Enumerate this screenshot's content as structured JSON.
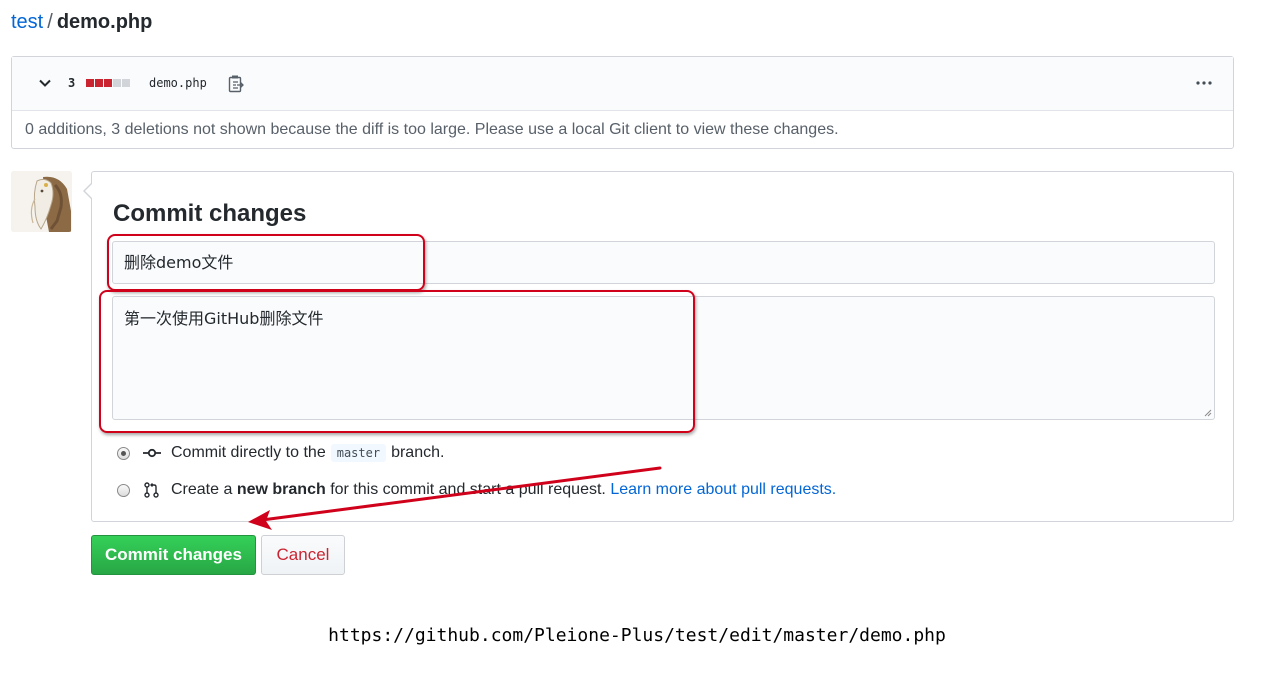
{
  "breadcrumb": {
    "repo": "test",
    "separator": "/",
    "file": "demo.php"
  },
  "file_header": {
    "deletions": "3",
    "diffstat_colors": [
      "#cb2431",
      "#cb2431",
      "#cb2431",
      "#d1d5da",
      "#d1d5da"
    ],
    "file_name": "demo.php",
    "icons": [
      "chevron-down-icon",
      "clipboard-icon",
      "kebab-horizontal-icon"
    ]
  },
  "file_message": "0 additions, 3 deletions not shown because the diff is too large. Please use a local Git client to view these changes.",
  "commit": {
    "title": "Commit changes",
    "summary_value": "删除demo文件",
    "description_value": "第一次使用GitHub删除文件",
    "option_direct": {
      "before": "Commit directly to the",
      "branch": "master",
      "after": "branch.",
      "checked": true
    },
    "option_new_branch": {
      "before": "Create a",
      "bold": "new branch",
      "after": "for this commit and start a pull request.",
      "link": "Learn more about pull requests.",
      "checked": false
    }
  },
  "buttons": {
    "commit": "Commit changes",
    "cancel": "Cancel"
  },
  "caption_url": "https://github.com/Pleione-Plus/test/edit/master/demo.php",
  "colors": {
    "link": "#0366d6",
    "commit_green": "#28a745",
    "cancel_red": "#cb2431",
    "annotation_red": "#d0021b"
  }
}
